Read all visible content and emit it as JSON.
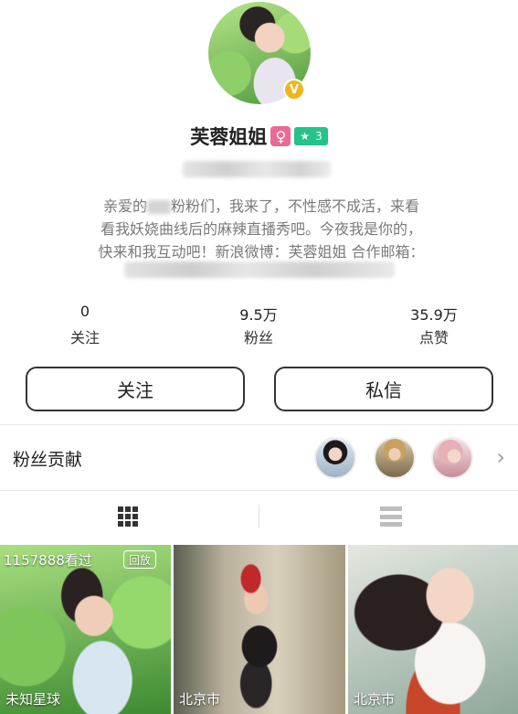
{
  "profile": {
    "name": "芙蓉姐姐",
    "gender_icon": "female-icon",
    "level": "3",
    "verified_badge": "V",
    "bio_lines": [
      [
        "亲爱的",
        "粉粉们，我来了，不性感不成活，来看"
      ],
      "看我妖娆曲线后的麻辣直播秀吧。今夜我是你的，",
      "快来和我互动吧！新浪微博：芙蓉姐姐  合作邮箱："
    ]
  },
  "stats": [
    {
      "value": "0",
      "label": "关注"
    },
    {
      "value": "9.5万",
      "label": "粉丝"
    },
    {
      "value": "35.9万",
      "label": "点赞"
    }
  ],
  "buttons": {
    "follow": "关注",
    "message": "私信"
  },
  "fans": {
    "title": "粉丝贡献",
    "chevron": "›"
  },
  "thumbs": [
    {
      "views": "1157888看过",
      "tag": "回放",
      "location": "未知星球"
    },
    {
      "location": "北京市"
    },
    {
      "location": "北京市"
    }
  ],
  "colors": {
    "female_badge": "#e86b94",
    "level_badge": "#23c38a",
    "verified_badge": "#f2b51a"
  }
}
